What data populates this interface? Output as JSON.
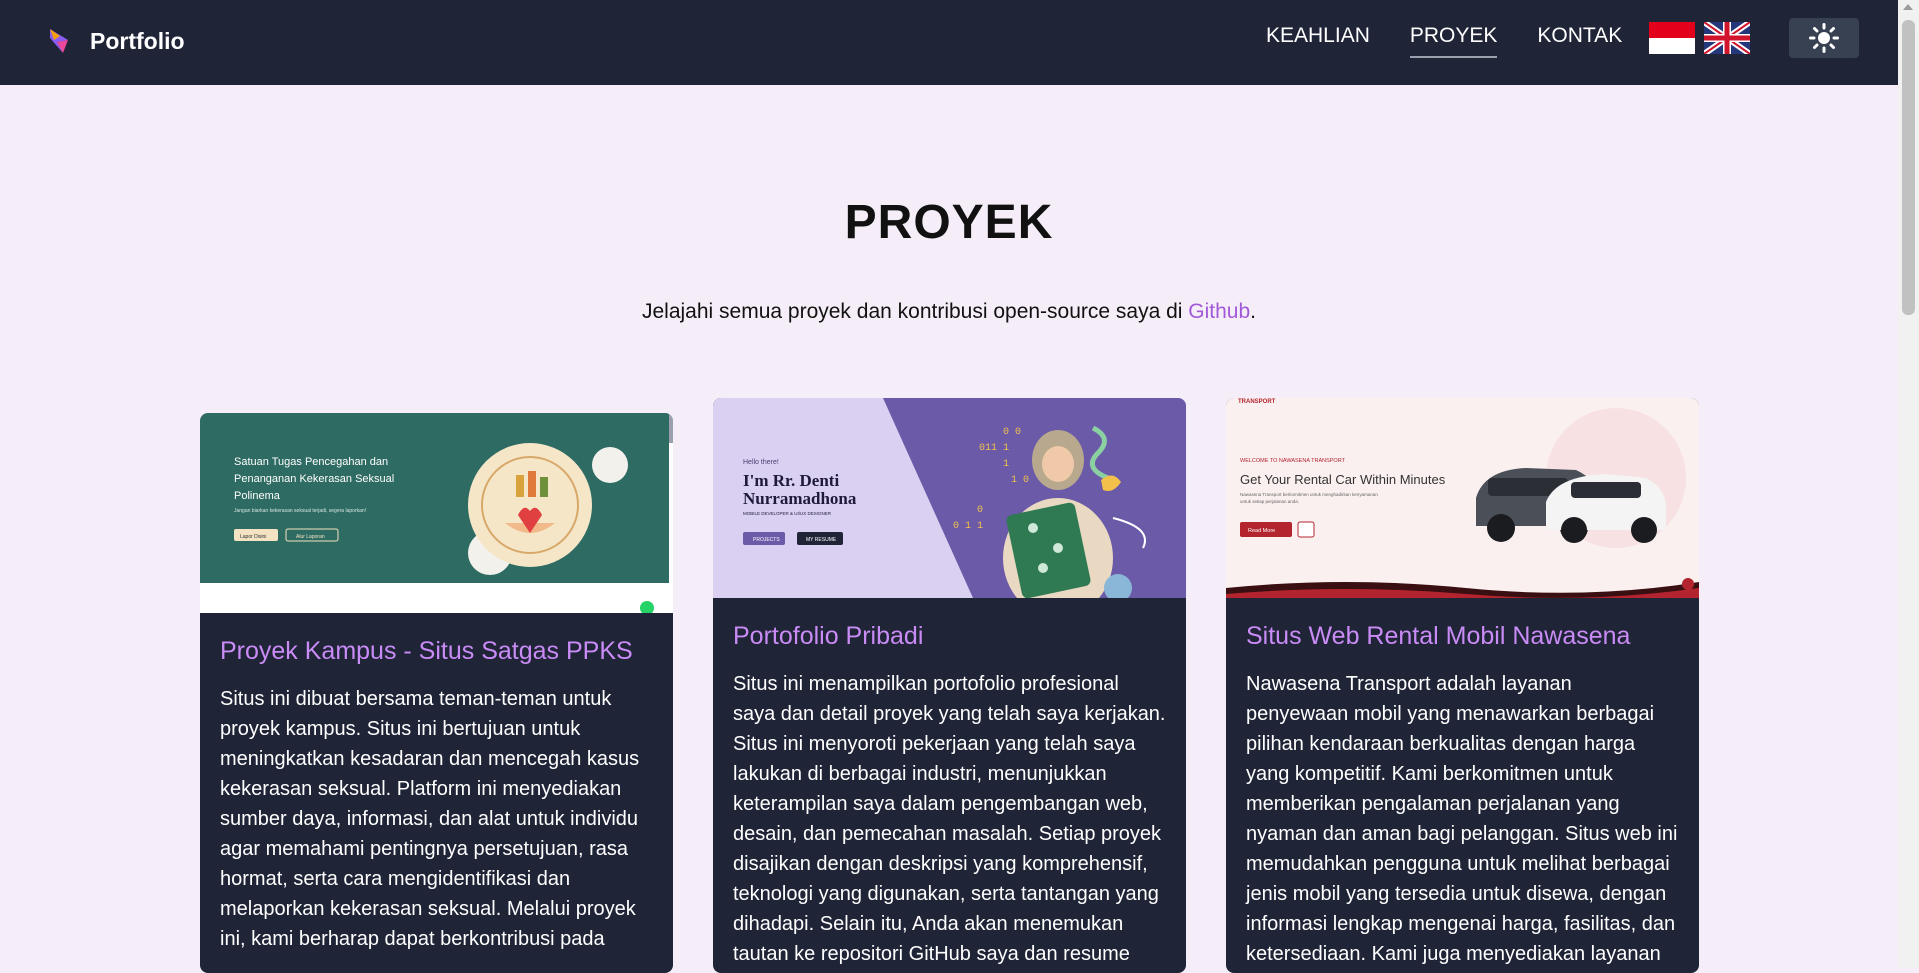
{
  "navbar": {
    "brand": "Portfolio",
    "links": [
      {
        "label": "KEAHLIAN",
        "active": false
      },
      {
        "label": "PROYEK",
        "active": true
      },
      {
        "label": "KONTAK",
        "active": false
      }
    ],
    "bg_color": "#1f2437"
  },
  "section": {
    "title": "PROYEK",
    "subtitle_before": "Jelajahi semua proyek dan kontribusi open-source saya di ",
    "subtitle_link": "Github",
    "subtitle_after": "."
  },
  "projects": [
    {
      "title": "Proyek Kampus - Situs Satgas PPKS",
      "description": "Situs ini dibuat bersama teman-teman untuk proyek kampus. Situs ini bertujuan untuk meningkatkan kesadaran dan mencegah kasus kekerasan seksual. Platform ini menyediakan sumber daya, informasi, dan alat untuk individu agar memahami pentingnya persetujuan, rasa hormat, serta cara mengidentifikasi dan melaporkan kekerasan seksual. Melalui proyek ini, kami berharap dapat berkontribusi pada",
      "thumb": {
        "heading": "Satuan Tugas Pencegahan dan Penanganan Kekerasan Seksual Polinema",
        "tagline": "Jangan biarkan kekerasan seksual terjadi, segera laporkan!",
        "btn1": "Lapor Disini",
        "btn2": "Alur Laporan"
      }
    },
    {
      "title": "Portofolio Pribadi",
      "description": "Situs ini menampilkan portofolio profesional saya dan detail proyek yang telah saya kerjakan. Situs ini menyoroti pekerjaan yang telah saya lakukan di berbagai industri, menunjukkan keterampilan saya dalam pengembangan web, desain, dan pemecahan masalah. Setiap proyek disajikan dengan deskripsi yang komprehensif, teknologi yang digunakan, serta tantangan yang dihadapi. Selain itu, Anda akan menemukan tautan ke repositori GitHub saya dan resume",
      "thumb": {
        "greeting": "Hello there!",
        "name": "I'm Rr. Denti Nurramadhona",
        "role": "MOBILE DEVELOPER & UI/UX DESIGNER",
        "btn1": "PROJECTS",
        "btn2": "MY RESUME"
      }
    },
    {
      "title": "Situs Web Rental Mobil Nawasena",
      "description": "Nawasena Transport adalah layanan penyewaan mobil yang menawarkan berbagai pilihan kendaraan berkualitas dengan harga yang kompetitif. Kami berkomitmen untuk memberikan pengalaman perjalanan yang nyaman dan aman bagi pelanggan. Situs web ini memudahkan pengguna untuk melihat berbagai jenis mobil yang tersedia untuk disewa, dengan informasi lengkap mengenai harga, fasilitas, dan ketersediaan. Kami juga menyediakan layanan",
      "thumb": {
        "brand": "TRANSPORT",
        "kicker": "WELCOME TO NAWASENA TRANSPORT",
        "heading": "Get Your Rental Car Within Minutes",
        "body": "Nawasena Transport berkomitmen untuk menghadirkan kenyamanan perjalanan untuk setiap perjalanan anda.",
        "btn": "Read More"
      }
    }
  ]
}
